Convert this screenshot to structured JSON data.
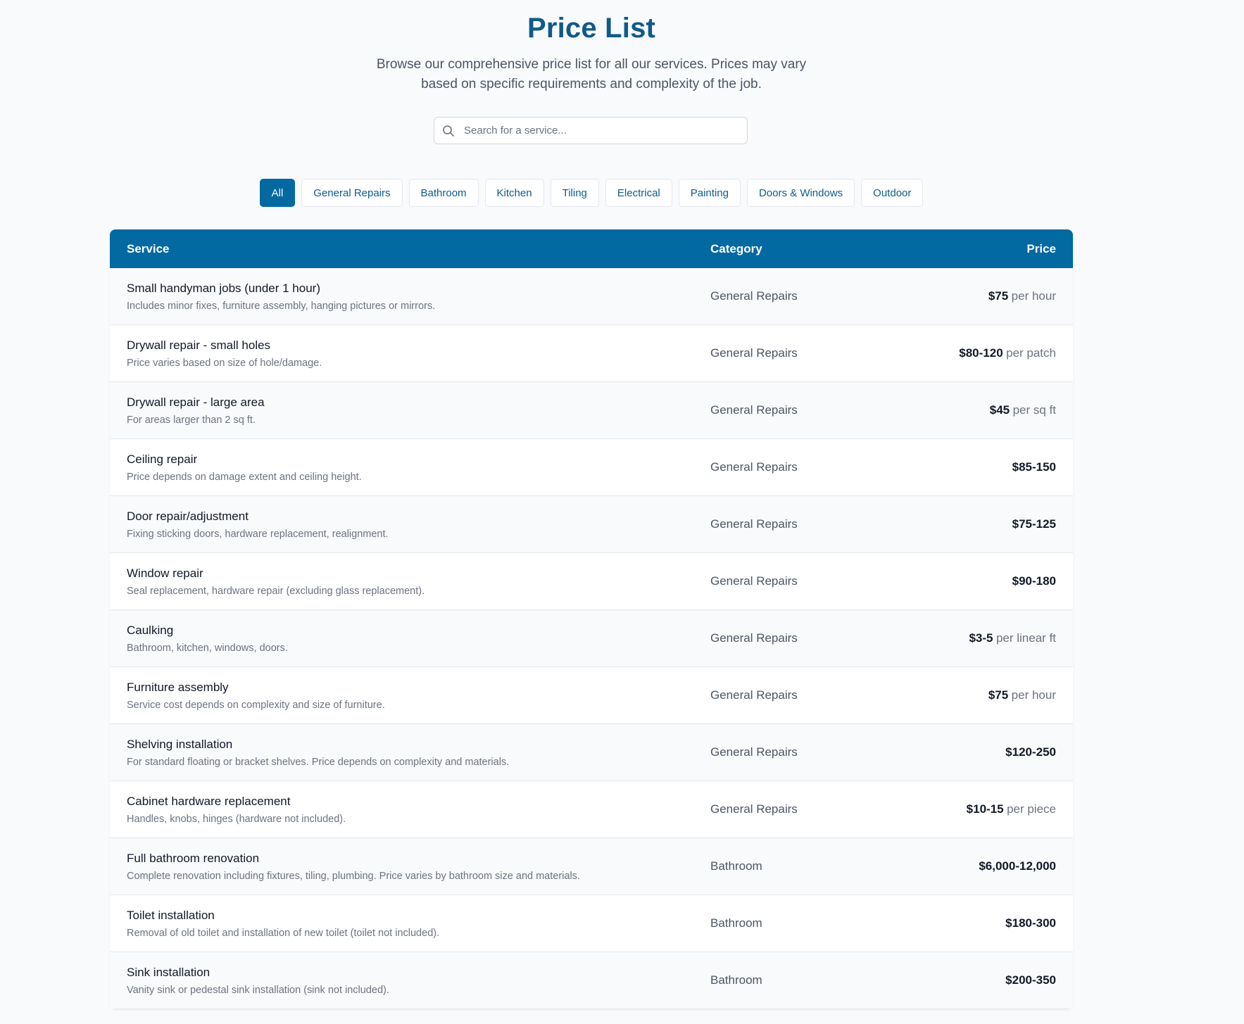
{
  "header": {
    "title": "Price List",
    "subtitle": "Browse our comprehensive price list for all our services. Prices may vary based on specific requirements and complexity of the job."
  },
  "search": {
    "placeholder": "Search for a service...",
    "value": ""
  },
  "filters": [
    "All",
    "General Repairs",
    "Bathroom",
    "Kitchen",
    "Tiling",
    "Electrical",
    "Painting",
    "Doors & Windows",
    "Outdoor"
  ],
  "active_filter": "All",
  "table": {
    "columns": {
      "service": "Service",
      "category": "Category",
      "price": "Price"
    },
    "rows": [
      {
        "name": "Small handyman jobs (under 1 hour)",
        "desc": "Includes minor fixes, furniture assembly, hanging pictures or mirrors.",
        "category": "General Repairs",
        "price": "$75",
        "unit": "per hour"
      },
      {
        "name": "Drywall repair - small holes",
        "desc": "Price varies based on size of hole/damage.",
        "category": "General Repairs",
        "price": "$80-120",
        "unit": "per patch"
      },
      {
        "name": "Drywall repair - large area",
        "desc": "For areas larger than 2 sq ft.",
        "category": "General Repairs",
        "price": "$45",
        "unit": "per sq ft"
      },
      {
        "name": "Ceiling repair",
        "desc": "Price depends on damage extent and ceiling height.",
        "category": "General Repairs",
        "price": "$85-150",
        "unit": ""
      },
      {
        "name": "Door repair/adjustment",
        "desc": "Fixing sticking doors, hardware replacement, realignment.",
        "category": "General Repairs",
        "price": "$75-125",
        "unit": ""
      },
      {
        "name": "Window repair",
        "desc": "Seal replacement, hardware repair (excluding glass replacement).",
        "category": "General Repairs",
        "price": "$90-180",
        "unit": ""
      },
      {
        "name": "Caulking",
        "desc": "Bathroom, kitchen, windows, doors.",
        "category": "General Repairs",
        "price": "$3-5",
        "unit": "per linear ft"
      },
      {
        "name": "Furniture assembly",
        "desc": "Service cost depends on complexity and size of furniture.",
        "category": "General Repairs",
        "price": "$75",
        "unit": "per hour"
      },
      {
        "name": "Shelving installation",
        "desc": "For standard floating or bracket shelves. Price depends on complexity and materials.",
        "category": "General Repairs",
        "price": "$120-250",
        "unit": ""
      },
      {
        "name": "Cabinet hardware replacement",
        "desc": "Handles, knobs, hinges (hardware not included).",
        "category": "General Repairs",
        "price": "$10-15",
        "unit": "per piece"
      },
      {
        "name": "Full bathroom renovation",
        "desc": "Complete renovation including fixtures, tiling, plumbing. Price varies by bathroom size and materials.",
        "category": "Bathroom",
        "price": "$6,000-12,000",
        "unit": ""
      },
      {
        "name": "Toilet installation",
        "desc": "Removal of old toilet and installation of new toilet (toilet not included).",
        "category": "Bathroom",
        "price": "$180-300",
        "unit": ""
      },
      {
        "name": "Sink installation",
        "desc": "Vanity sink or pedestal sink installation (sink not included).",
        "category": "Bathroom",
        "price": "$200-350",
        "unit": ""
      }
    ]
  },
  "colors": {
    "brand": "#0369a1",
    "title": "#0f5a8a",
    "background": "#f8fafc"
  }
}
